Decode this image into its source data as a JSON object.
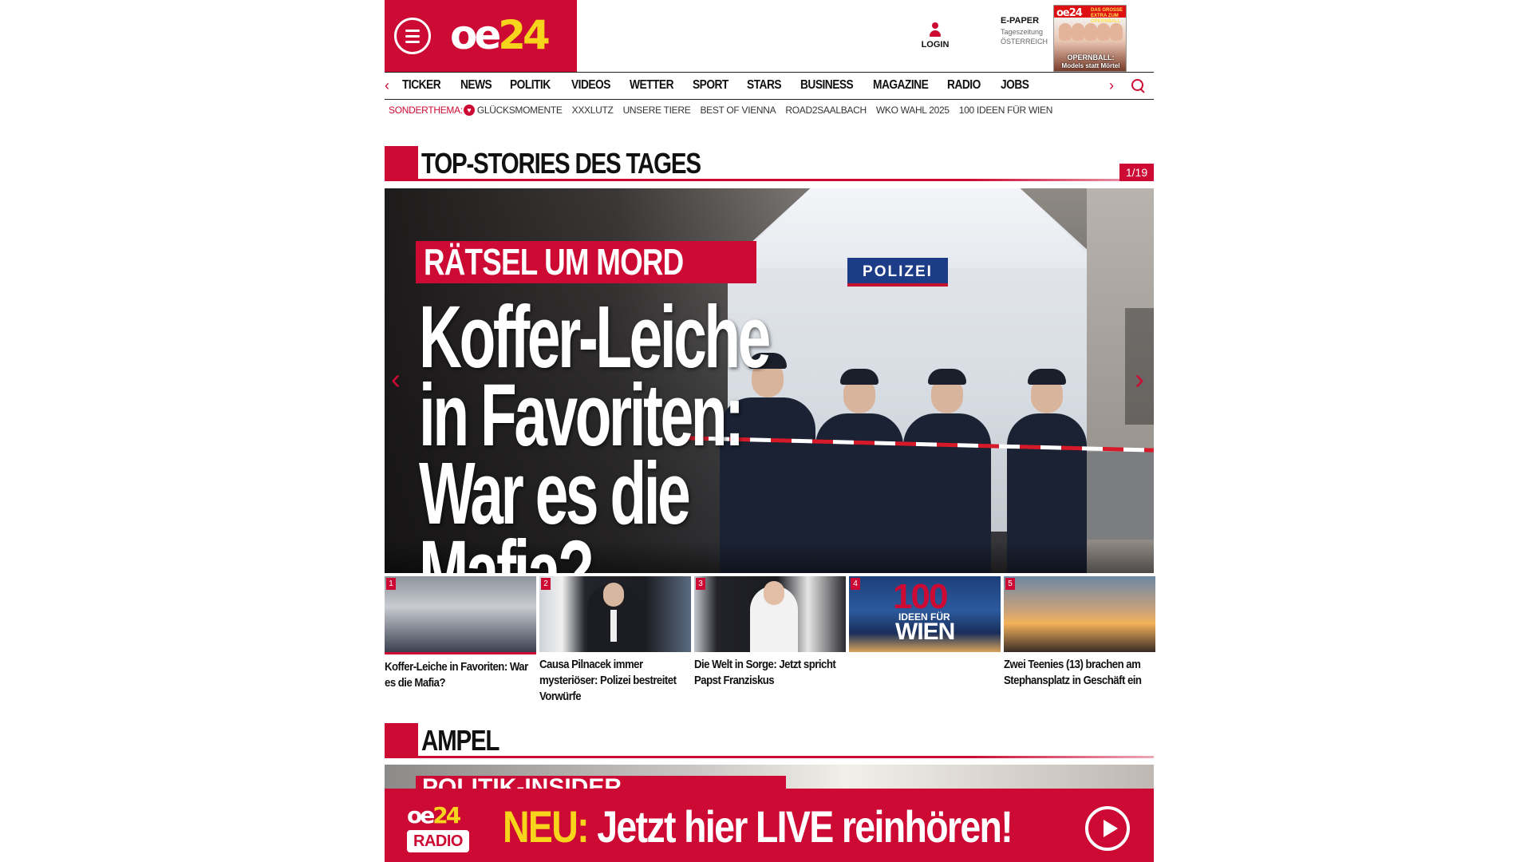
{
  "brand": {
    "logo_oe": "oe",
    "logo_num": "24",
    "accent": "#cc0a33",
    "yellow": "#f7d51c"
  },
  "header": {
    "login_label": "LOGIN",
    "epaper": {
      "title": "E-PAPER",
      "line2": "Tageszeitung",
      "line3": "ÖSTERREICH"
    },
    "epaper_cover": {
      "logo": "oe24",
      "badge": "DAS GROSSE EXTRA ZUM OPERNBALL",
      "headline": "OPERNBALL:",
      "subline": "Models statt Mörtel"
    }
  },
  "nav": {
    "items": [
      "TICKER",
      "NEWS",
      "POLITIK",
      "VIDEOS",
      "WETTER",
      "SPORT",
      "STARS",
      "BUSINESS",
      "MAGAZINE",
      "RADIO",
      "JOBS"
    ],
    "left_arrow": "‹",
    "right_arrow": "›"
  },
  "subnav": {
    "lead": "SONDERTHEMA:",
    "items": [
      "GLÜCKSMOMENTE",
      "XXXLUTZ",
      "UNSERE TIERE",
      "BEST OF VIENNA",
      "ROAD2SAALBACH",
      "WKO WAHL 2025",
      "100 IDEEN FÜR WIEN"
    ]
  },
  "top_stories": {
    "title": "TOP-STORIES DES TAGES",
    "pager": "1/19",
    "hero": {
      "kicker": "RÄTSEL UM MORD",
      "headline_lines": [
        "Koffer-Leiche",
        "in Favoriten:",
        "War es die Mafia?"
      ],
      "image_label": "POLIZEI"
    },
    "thumbs": [
      {
        "num": "1",
        "caption": "Koffer-Leiche in Favoriten: War es die Mafia?"
      },
      {
        "num": "2",
        "caption": "Causa Pilnacek immer mysteriöser: Polizei bestreitet Vorwürfe"
      },
      {
        "num": "3",
        "caption": "Die Welt in Sorge: Jetzt spricht Papst Franziskus"
      },
      {
        "num": "4",
        "caption": "",
        "image_text": {
          "big": "100",
          "mid": "IDEEN FÜR",
          "low": "WIEN"
        }
      },
      {
        "num": "5",
        "caption": "Zwei Teenies (13) brachen am Stephansplatz in Geschäft ein"
      }
    ]
  },
  "ampel": {
    "title": "AMPEL",
    "teaser_kicker": "POLITIK-INSIDER"
  },
  "radio_banner": {
    "logo_oe": "oe",
    "logo_num": "24",
    "logo_radio": "RADIO",
    "neu": "NEU:",
    "slogan": " Jetzt hier LIVE reinhören!"
  }
}
